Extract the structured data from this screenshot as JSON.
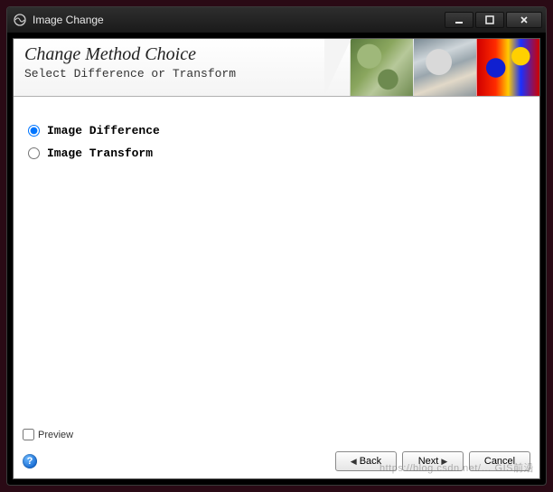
{
  "window": {
    "title": "Image Change"
  },
  "header": {
    "title": "Change Method Choice",
    "subtitle": "Select Difference or Transform"
  },
  "options": {
    "difference": {
      "label": "Image Difference",
      "selected": true
    },
    "transform": {
      "label": "Image Transform",
      "selected": false
    }
  },
  "footer": {
    "preview_label": "Preview",
    "back_label": "Back",
    "next_label": "Next",
    "cancel_label": "Cancel",
    "help_glyph": "?"
  },
  "watermark": "https://blog.csdn.net/…  GIS前沿"
}
